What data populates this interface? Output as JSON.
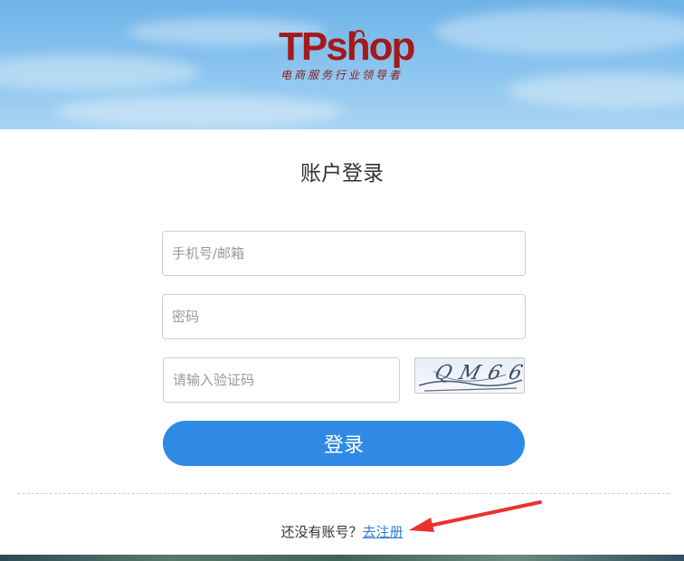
{
  "brand": {
    "logo_text": "TPshop",
    "tagline": "电商服务行业领导者"
  },
  "login": {
    "title": "账户登录",
    "phone_placeholder": "手机号/邮箱",
    "password_placeholder": "密码",
    "captcha_placeholder": "请输入验证码",
    "captcha_text": "QM66",
    "submit_label": "登录"
  },
  "register": {
    "prompt": "还没有账号？",
    "link_label": "去注册"
  },
  "colors": {
    "primary": "#2f8ae6",
    "logo": "#a21a1a",
    "arrow": "#e8322f"
  }
}
